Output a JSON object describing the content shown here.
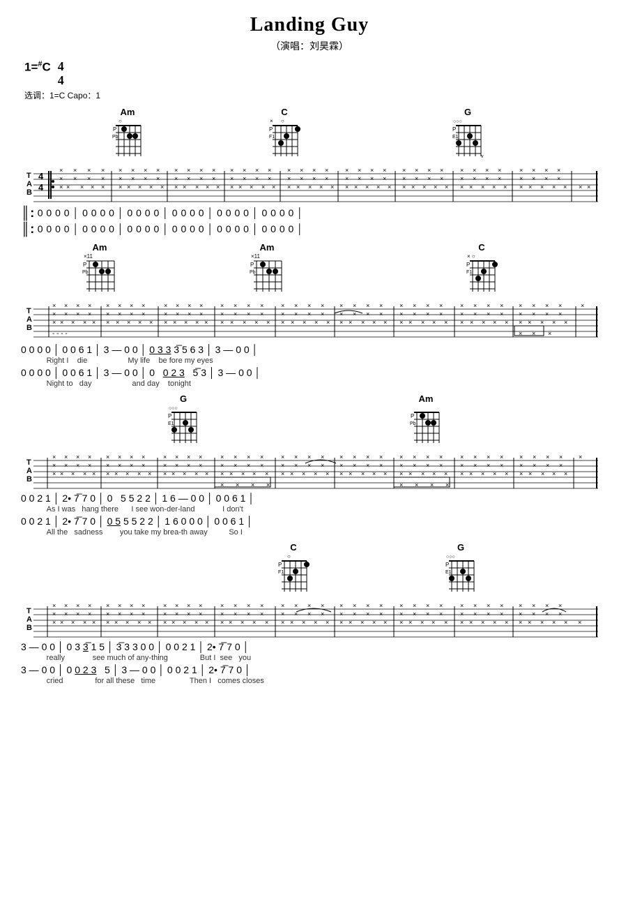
{
  "title": "Landing Guy",
  "subtitle": "（演唱：刘昊霖）",
  "key": "1=♯C",
  "time_signature": "4/4",
  "capo_info": "选调：1=C   Capo：1",
  "sections": [
    {
      "id": "section1",
      "chords": [
        {
          "name": "Am",
          "position": 140,
          "fret_start": null
        },
        {
          "name": "C",
          "position": 370,
          "fret_start": null
        },
        {
          "name": "G",
          "position": 630,
          "fret_start": null
        }
      ],
      "notation_line1": "║: 0  0  0  0  │ 0  0  0  0  │ 0  0  0  0  │ 0  0  0  0  │ 0  0  0  0  │ 0  0  0  0  │",
      "notation_line2": "║: 0  0  0  0  │ 0  0  0  0  │ 0  0  0  0  │ 0  0  0  0  │ 0  0  0  0  │ 0  0  0  0  │"
    },
    {
      "id": "section2",
      "chords": [
        {
          "name": "Am",
          "position": 100,
          "fret_start": "×11"
        },
        {
          "name": "Am",
          "position": 340,
          "fret_start": "×11"
        },
        {
          "name": "C",
          "position": 650,
          "fret_start": null
        }
      ],
      "notation_line1": "0  0  0  0  │ 0  0  6  1  │ 3  —  0  0  │ 0̲3̲3   3̄  5  6  3  │ 3  —  0  0  │",
      "lyrics_line1": "Right  I   die              My life    be fore my eyes",
      "notation_line2": "0  0  0  0  │ 0  0  6  1  │ 3  —  0  0  │ 0   0̲2̲3   5̄  3  │ 3  —  0  0  │",
      "lyrics_line2": "Night  to   day              and day    tonight"
    },
    {
      "id": "section3",
      "chords": [
        {
          "name": "G",
          "position": 220,
          "fret_start": null
        },
        {
          "name": "Am",
          "position": 570,
          "fret_start": null
        }
      ],
      "notation_line1": "0  0  2  1  │ 2•  7̄  7  0  │ 0   5  5  2  2  │ 1  6  —  0  0  │ 0  0  6  1  │",
      "lyrics_line1": "As I was   hang  there       I  see won-der-land              I don't",
      "notation_line2": "0  0  2  1  │ 2•  7̄  7  0  │ 0̲5̲  5  5  2  2  │ 1  6  0  0  0  │ 0  0  6  1  │",
      "lyrics_line2": "All the   sadness          you take my  brea-th  away              So  I"
    },
    {
      "id": "section4",
      "chords": [
        {
          "name": "C",
          "position": 380,
          "fret_start": null
        },
        {
          "name": "G",
          "position": 620,
          "fret_start": null
        }
      ],
      "notation_line1": "3  —  0  0  │ 0  3  3̲  1  5  │ 3̄  3  3  0  0  │ 0  0  2  1  │ 2•  7̄  7  0  │",
      "lyrics_line1": "really          see  much  of  any-thing              But  I   see   you",
      "notation_line2": "3  —  0  0  │ 0  0̲2̲3   5  │ 3  —  0  0  │ 0  0  2  1  │ 2•  7̄  7  0  │",
      "lyrics_line2": "cried          for all  these  time              Then  I   comes closes"
    }
  ]
}
